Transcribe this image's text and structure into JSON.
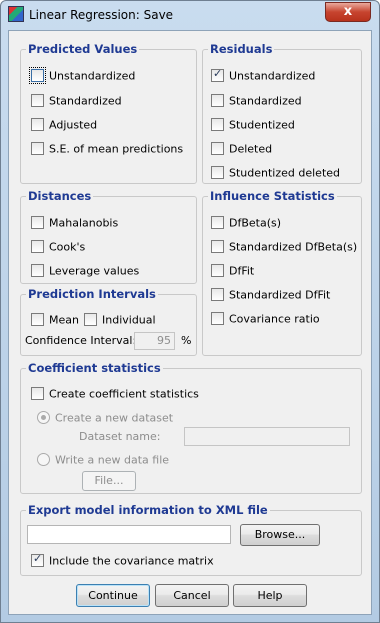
{
  "window": {
    "title": "Linear Regression: Save",
    "close_label": "x"
  },
  "predicted_values": {
    "title": "Predicted Values",
    "items": [
      {
        "label": "Unstandardized",
        "checked": false
      },
      {
        "label": "Standardized",
        "checked": false
      },
      {
        "label": "Adjusted",
        "checked": false
      },
      {
        "label": "S.E. of mean predictions",
        "checked": false
      }
    ]
  },
  "residuals": {
    "title": "Residuals",
    "items": [
      {
        "label": "Unstandardized",
        "checked": true
      },
      {
        "label": "Standardized",
        "checked": false
      },
      {
        "label": "Studentized",
        "checked": false
      },
      {
        "label": "Deleted",
        "checked": false
      },
      {
        "label": "Studentized deleted",
        "checked": false
      }
    ]
  },
  "distances": {
    "title": "Distances",
    "items": [
      {
        "label": "Mahalanobis",
        "checked": false
      },
      {
        "label": "Cook's",
        "checked": false
      },
      {
        "label": "Leverage values",
        "checked": false
      }
    ]
  },
  "influence": {
    "title": "Influence Statistics",
    "items": [
      {
        "label": "DfBeta(s)",
        "checked": false
      },
      {
        "label": "Standardized DfBeta(s)",
        "checked": false
      },
      {
        "label": "DfFit",
        "checked": false
      },
      {
        "label": "Standardized DfFit",
        "checked": false
      },
      {
        "label": "Covariance ratio",
        "checked": false
      }
    ]
  },
  "prediction_intervals": {
    "title": "Prediction Intervals",
    "mean_label": "Mean",
    "individual_label": "Individual",
    "confidence_label": "Confidence Interval:",
    "confidence_value": "95",
    "percent": "%"
  },
  "coefficient": {
    "title": "Coefficient statistics",
    "create_label": "Create coefficient statistics",
    "new_dataset_label": "Create a new dataset",
    "dataset_name_label": "Dataset name:",
    "write_file_label": "Write a new data file",
    "file_button": "File..."
  },
  "export": {
    "title": "Export model information to XML file",
    "path_value": "",
    "browse_button": "Browse...",
    "include_cov_label": "Include the covariance matrix",
    "include_cov_checked": true
  },
  "buttons": {
    "continue": "Continue",
    "cancel": "Cancel",
    "help": "Help"
  }
}
